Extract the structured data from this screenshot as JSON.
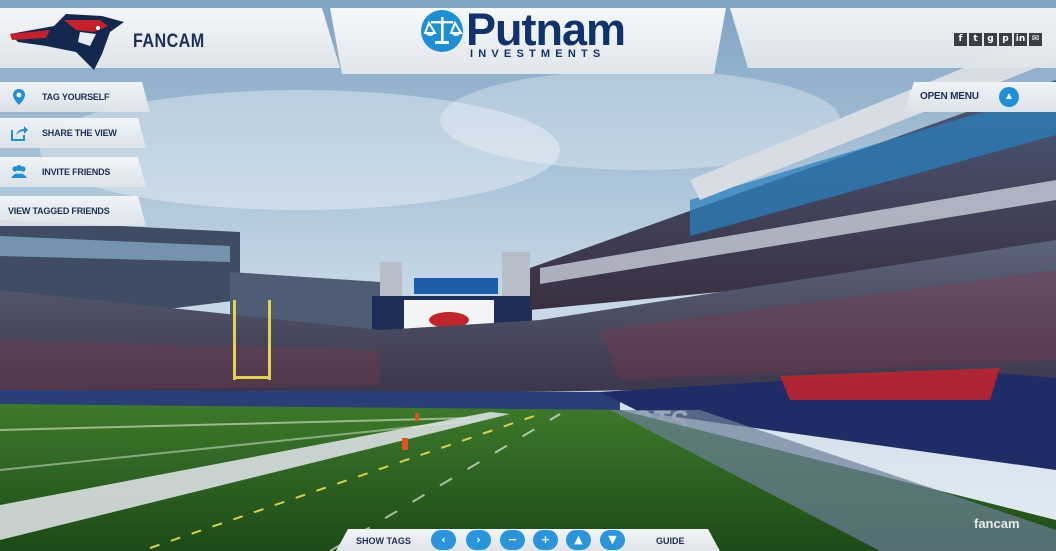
{
  "brand": {
    "title": "FANCAM"
  },
  "sponsor": {
    "name": "Putnam",
    "subtitle": "INVESTMENTS"
  },
  "actions": [
    {
      "label": "TAG YOURSELF",
      "icon": "map-pin-icon"
    },
    {
      "label": "SHARE THE VIEW",
      "icon": "share-icon"
    },
    {
      "label": "INVITE FRIENDS",
      "icon": "people-icon"
    },
    {
      "label": "VIEW TAGGED FRIENDS",
      "icon": ""
    }
  ],
  "menu": {
    "open_label": "OPEN MENU"
  },
  "social": [
    {
      "icon": "facebook-icon",
      "glyph": "f"
    },
    {
      "icon": "twitter-icon",
      "glyph": "t"
    },
    {
      "icon": "google-icon",
      "glyph": "g"
    },
    {
      "icon": "pinterest-icon",
      "glyph": "p"
    },
    {
      "icon": "linkedin-icon",
      "glyph": "in"
    },
    {
      "icon": "email-icon",
      "glyph": "✉"
    }
  ],
  "controls": {
    "show_tags": "SHOW TAGS",
    "guide": "GUIDE",
    "buttons": [
      {
        "name": "pan-left",
        "glyph": "‹"
      },
      {
        "name": "pan-right",
        "glyph": "›"
      },
      {
        "name": "zoom-out",
        "glyph": "−"
      },
      {
        "name": "zoom-in",
        "glyph": "+"
      },
      {
        "name": "pan-up",
        "glyph": "▲"
      },
      {
        "name": "pan-down",
        "glyph": "▼"
      }
    ]
  },
  "scene": {
    "fence_text": "PATRIOTS"
  },
  "watermark": "fancam",
  "colors": {
    "accent": "#2b95dc",
    "navy": "#1d2f57",
    "sponsor_navy": "#11336b"
  }
}
